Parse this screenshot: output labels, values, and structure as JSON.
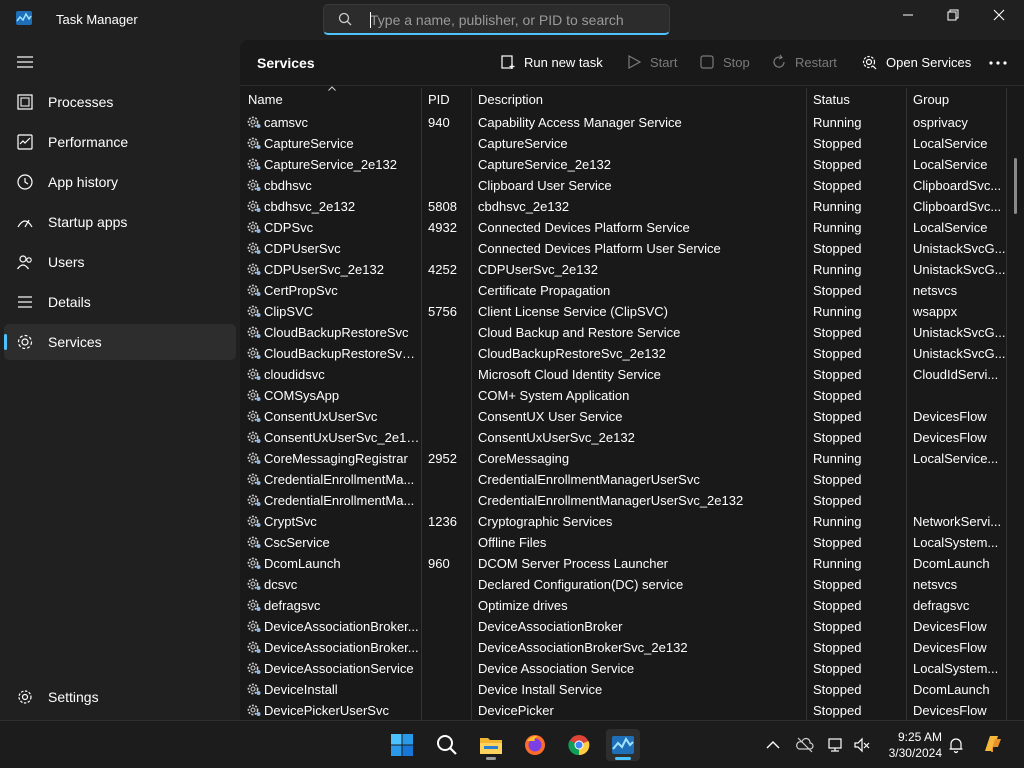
{
  "window": {
    "title": "Task Manager",
    "search_placeholder": "Type a name, publisher, or PID to search",
    "search_value": ""
  },
  "sidebar": {
    "items": [
      {
        "label": "Processes",
        "icon": "processes-icon"
      },
      {
        "label": "Performance",
        "icon": "performance-icon"
      },
      {
        "label": "App history",
        "icon": "app-history-icon"
      },
      {
        "label": "Startup apps",
        "icon": "startup-apps-icon"
      },
      {
        "label": "Users",
        "icon": "users-icon"
      },
      {
        "label": "Details",
        "icon": "details-icon"
      },
      {
        "label": "Services",
        "icon": "services-icon",
        "active": true
      }
    ],
    "settings_label": "Settings"
  },
  "commandbar": {
    "page_title": "Services",
    "run_new_task": "Run new task",
    "start": "Start",
    "stop": "Stop",
    "restart": "Restart",
    "open_services": "Open Services"
  },
  "table": {
    "columns": [
      "Name",
      "PID",
      "Description",
      "Status",
      "Group"
    ],
    "rows": [
      [
        "camsvc",
        "940",
        "Capability Access Manager Service",
        "Running",
        "osprivacy"
      ],
      [
        "CaptureService",
        "",
        "CaptureService",
        "Stopped",
        "LocalService"
      ],
      [
        "CaptureService_2e132",
        "",
        "CaptureService_2e132",
        "Stopped",
        "LocalService"
      ],
      [
        "cbdhsvc",
        "",
        "Clipboard User Service",
        "Stopped",
        "ClipboardSvc..."
      ],
      [
        "cbdhsvc_2e132",
        "5808",
        "cbdhsvc_2e132",
        "Running",
        "ClipboardSvc..."
      ],
      [
        "CDPSvc",
        "4932",
        "Connected Devices Platform Service",
        "Running",
        "LocalService"
      ],
      [
        "CDPUserSvc",
        "",
        "Connected Devices Platform User Service",
        "Stopped",
        "UnistackSvcG..."
      ],
      [
        "CDPUserSvc_2e132",
        "4252",
        "CDPUserSvc_2e132",
        "Running",
        "UnistackSvcG..."
      ],
      [
        "CertPropSvc",
        "",
        "Certificate Propagation",
        "Stopped",
        "netsvcs"
      ],
      [
        "ClipSVC",
        "5756",
        "Client License Service (ClipSVC)",
        "Running",
        "wsappx"
      ],
      [
        "CloudBackupRestoreSvc",
        "",
        "Cloud Backup and Restore Service",
        "Stopped",
        "UnistackSvcG..."
      ],
      [
        "CloudBackupRestoreSvc_...",
        "",
        "CloudBackupRestoreSvc_2e132",
        "Stopped",
        "UnistackSvcG..."
      ],
      [
        "cloudidsvc",
        "",
        "Microsoft Cloud Identity Service",
        "Stopped",
        "CloudIdServi..."
      ],
      [
        "COMSysApp",
        "",
        "COM+ System Application",
        "Stopped",
        ""
      ],
      [
        "ConsentUxUserSvc",
        "",
        "ConsentUX User Service",
        "Stopped",
        "DevicesFlow"
      ],
      [
        "ConsentUxUserSvc_2e132",
        "",
        "ConsentUxUserSvc_2e132",
        "Stopped",
        "DevicesFlow"
      ],
      [
        "CoreMessagingRegistrar",
        "2952",
        "CoreMessaging",
        "Running",
        "LocalService..."
      ],
      [
        "CredentialEnrollmentMa...",
        "",
        "CredentialEnrollmentManagerUserSvc",
        "Stopped",
        ""
      ],
      [
        "CredentialEnrollmentMa...",
        "",
        "CredentialEnrollmentManagerUserSvc_2e132",
        "Stopped",
        ""
      ],
      [
        "CryptSvc",
        "1236",
        "Cryptographic Services",
        "Running",
        "NetworkServi..."
      ],
      [
        "CscService",
        "",
        "Offline Files",
        "Stopped",
        "LocalSystem..."
      ],
      [
        "DcomLaunch",
        "960",
        "DCOM Server Process Launcher",
        "Running",
        "DcomLaunch"
      ],
      [
        "dcsvc",
        "",
        "Declared Configuration(DC) service",
        "Stopped",
        "netsvcs"
      ],
      [
        "defragsvc",
        "",
        "Optimize drives",
        "Stopped",
        "defragsvc"
      ],
      [
        "DeviceAssociationBroker...",
        "",
        "DeviceAssociationBroker",
        "Stopped",
        "DevicesFlow"
      ],
      [
        "DeviceAssociationBroker...",
        "",
        "DeviceAssociationBrokerSvc_2e132",
        "Stopped",
        "DevicesFlow"
      ],
      [
        "DeviceAssociationService",
        "",
        "Device Association Service",
        "Stopped",
        "LocalSystem..."
      ],
      [
        "DeviceInstall",
        "",
        "Device Install Service",
        "Stopped",
        "DcomLaunch"
      ],
      [
        "DevicePickerUserSvc",
        "",
        "DevicePicker",
        "Stopped",
        "DevicesFlow"
      ]
    ]
  },
  "taskbar": {
    "apps": [
      "start-icon",
      "search-icon",
      "file-explorer-icon",
      "firefox-icon",
      "chrome-icon",
      "task-manager-icon"
    ],
    "time": "9:25 AM",
    "date": "3/30/2024"
  },
  "colors": {
    "accent": "#4cc2ff",
    "background": "#202020",
    "content": "#191919",
    "disabled_text": "#7a7a7a"
  }
}
